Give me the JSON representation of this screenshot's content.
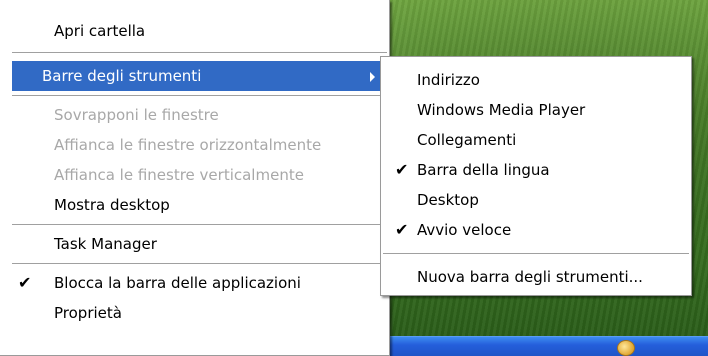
{
  "main_menu": {
    "open_folder": "Apri cartella",
    "toolbars": "Barre degli strumenti",
    "cascade_windows": "Sovrapponi le finestre",
    "tile_horizontal": "Affianca le finestre orizzontalmente",
    "tile_vertical": "Affianca le finestre verticalmente",
    "show_desktop": "Mostra desktop",
    "task_manager": "Task Manager",
    "lock_taskbar": "Blocca la barra delle applicazioni",
    "properties": "Proprietà"
  },
  "toolbars_submenu": {
    "items": [
      {
        "label": "Indirizzo",
        "checked": false
      },
      {
        "label": "Windows Media Player",
        "checked": false
      },
      {
        "label": "Collegamenti",
        "checked": false
      },
      {
        "label": "Barra della lingua",
        "checked": true
      },
      {
        "label": "Desktop",
        "checked": false
      },
      {
        "label": "Avvio veloce",
        "checked": true
      }
    ],
    "new_toolbar": "Nuova barra degli strumenti..."
  },
  "check_glyph": "✔",
  "colors": {
    "highlight": "#316ac5",
    "disabled_text": "#a8a8a8",
    "taskbar": "#245edb"
  },
  "icons": {
    "submenu_arrow": "chevron-right-icon",
    "checkmark": "checkmark-icon",
    "tray": "tray-icon"
  }
}
